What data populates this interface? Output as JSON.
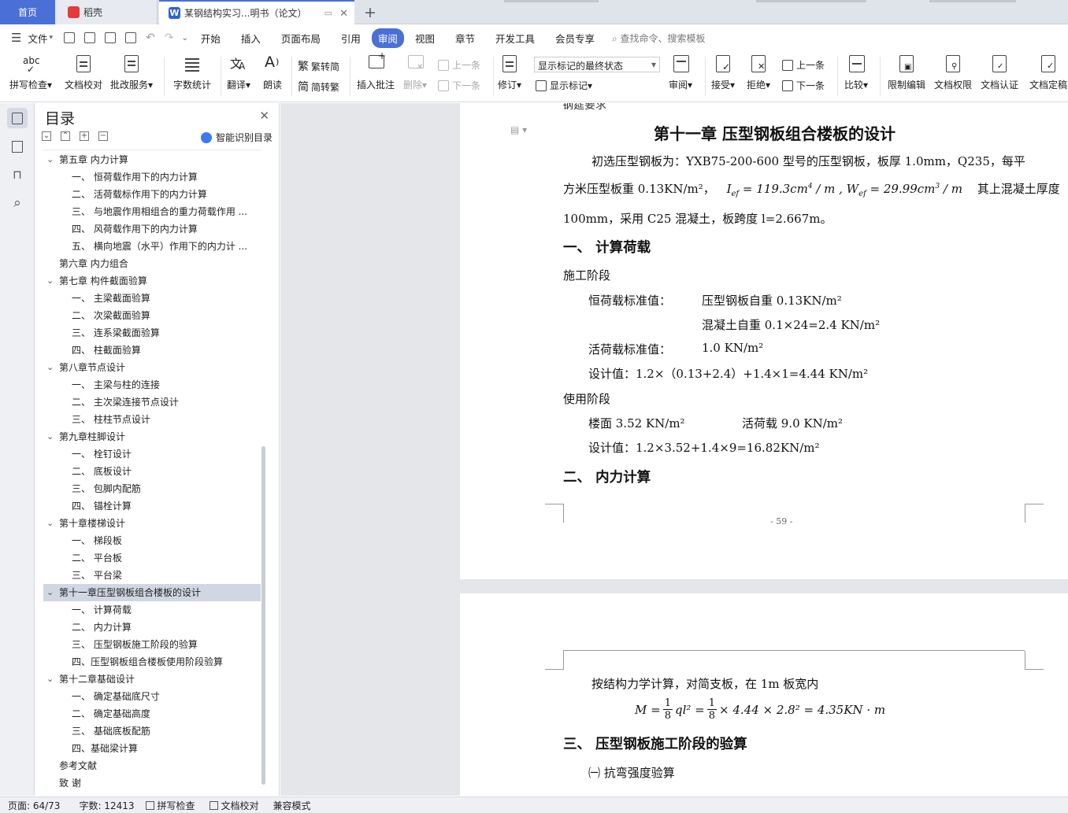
{
  "tabs": {
    "home": "首页",
    "daoke": "稻壳",
    "doc": "某钢结构实习...明书（论文）"
  },
  "menu": {
    "file": "文件",
    "items": [
      "开始",
      "插入",
      "页面布局",
      "引用",
      "审阅",
      "视图",
      "章节",
      "开发工具",
      "会员专享"
    ],
    "active_index": 4,
    "search": "查找命令、搜索模板"
  },
  "ribbon": {
    "spellcheck": "拼写检查",
    "doccheck": "文档校对",
    "batch": "批改服务",
    "wordcount": "字数统计",
    "translate": "翻译",
    "read": "朗读",
    "t2s": "繁转简",
    "s2t": "简转繁",
    "insert_comment": "插入批注",
    "delete": "删除",
    "prev": "上一条",
    "next": "下一条",
    "revise": "修订",
    "markup_state": "显示标记的最终状态",
    "show_markup": "显示标记",
    "review": "审阅",
    "accept": "接受",
    "reject": "拒绝",
    "prev2": "上一条",
    "next2": "下一条",
    "compare": "比较",
    "restrict": "限制编辑",
    "permission": "文档权限",
    "certify": "文档认证",
    "finalize": "文档定稿"
  },
  "toc": {
    "title": "目录",
    "smart": "智能识别目录",
    "items": [
      {
        "label": "第五章  内力计算",
        "level": 1,
        "caret": true
      },
      {
        "label": "一、   恒荷载作用下的内力计算",
        "level": 2
      },
      {
        "label": "二、   活荷载标作用下的内力计算",
        "level": 2
      },
      {
        "label": "三、   与地震作用相组合的重力荷载作用 ...",
        "level": 2
      },
      {
        "label": "四、   风荷载作用下的内力计算",
        "level": 2
      },
      {
        "label": "五、   横向地震（水平）作用下的内力计 ...",
        "level": 2
      },
      {
        "label": "第六章  内力组合",
        "level": 1,
        "caret": false
      },
      {
        "label": "第七章  构件截面验算",
        "level": 1,
        "caret": true
      },
      {
        "label": "一、   主梁截面验算",
        "level": 2
      },
      {
        "label": "二、   次梁截面验算",
        "level": 2
      },
      {
        "label": "三、   连系梁截面验算",
        "level": 2
      },
      {
        "label": "四、   柱截面验算",
        "level": 2
      },
      {
        "label": "第八章节点设计",
        "level": 1,
        "caret": true
      },
      {
        "label": "一、   主梁与柱的连接",
        "level": 2
      },
      {
        "label": "二、   主次梁连接节点设计",
        "level": 2
      },
      {
        "label": "三、   柱柱节点设计",
        "level": 2
      },
      {
        "label": "第九章柱脚设计",
        "level": 1,
        "caret": true
      },
      {
        "label": "一、   栓钉设计",
        "level": 2
      },
      {
        "label": "二、   底板设计",
        "level": 2
      },
      {
        "label": "三、   包脚内配筋",
        "level": 2
      },
      {
        "label": "四、   锚栓计算",
        "level": 2
      },
      {
        "label": "第十章楼梯设计",
        "level": 1,
        "caret": true
      },
      {
        "label": "一、   梯段板",
        "level": 2
      },
      {
        "label": "二、   平台板",
        "level": 2
      },
      {
        "label": "三、   平台梁",
        "level": 2
      },
      {
        "label": "第十一章压型钢板组合楼板的设计",
        "level": 1,
        "caret": true,
        "selected": true
      },
      {
        "label": "一、   计算荷载",
        "level": 2
      },
      {
        "label": "二、   内力计算",
        "level": 2
      },
      {
        "label": "三、   压型钢板施工阶段的验算",
        "level": 2
      },
      {
        "label": "四、压型钢板组合楼板使用阶段验算",
        "level": 2
      },
      {
        "label": "第十二章基础设计",
        "level": 1,
        "caret": true
      },
      {
        "label": "一、   确定基础底尺寸",
        "level": 2
      },
      {
        "label": "二、   确定基础高度",
        "level": 2
      },
      {
        "label": "三、   基础底板配筋",
        "level": 2
      },
      {
        "label": "四、基础梁计算",
        "level": 2
      },
      {
        "label": "参考文献",
        "level": 1,
        "caret": false
      },
      {
        "label": "致    谢",
        "level": 1,
        "caret": false
      }
    ]
  },
  "doc": {
    "cut_text": "钢筵要求",
    "chapter_title": "第十一章    压型钢板组合楼板的设计",
    "p1": "初选压型钢板为：YXB75-200-600 型号的压型钢板，板厚 1.0mm，Q235，每平",
    "p2a": "方米压型板重 0.13KN/m²，",
    "p2_formula": "I",
    "p2_formula_sub": "ef",
    "p2_formula_rest": " = 119.3cm",
    "p2_sup": "4",
    "p2_rest2": " / m , W",
    "p2_sub2": "ef",
    "p2_rest3": " = 29.99cm",
    "p2_sup2": "3",
    "p2_rest4": " / m",
    "p2b": "其上混凝土厚度",
    "p3": "100mm，采用 C25 混凝土，板跨度 l=2.667m。",
    "h1": "一、    计算荷载",
    "construction": "施工阶段",
    "dead_label": "恒荷载标准值：",
    "dead1": "压型钢板自重   0.13KN/m²",
    "dead2": "混凝土自重   0.1×24=2.4 KN/m²",
    "live_label": "活荷载标准值：",
    "live1": "1.0 KN/m²",
    "design1": "设计值：1.2×（0.13+2.4）+1.4×1=4.44 KN/m²",
    "use_stage": "使用阶段",
    "floor": "楼面 3.52 KN/m²",
    "live2": "活荷载 9.0 KN/m²",
    "design2": "设计值：1.2×3.52+1.4×9=16.82KN/m²",
    "h2": "二、    内力计算",
    "page_num": "- 59 -",
    "p_calc": "按结构力学计算，对简支板，在 1m 板宽内",
    "formula_M": "M = ",
    "formula_frac1_top": "1",
    "formula_frac1_bot": "8",
    "formula_mid": "ql² = ",
    "formula_frac2_top": "1",
    "formula_frac2_bot": "8",
    "formula_end": "× 4.44 × 2.8² = 4.35KN · m",
    "h3": "三、    压型钢板施工阶段的验算",
    "sub1": "㈠ 抗弯强度验算"
  },
  "status": {
    "page": "页面: 64/73",
    "words": "字数: 12413",
    "spell": "拼写检查",
    "proof": "文档校对",
    "compat": "兼容模式"
  }
}
